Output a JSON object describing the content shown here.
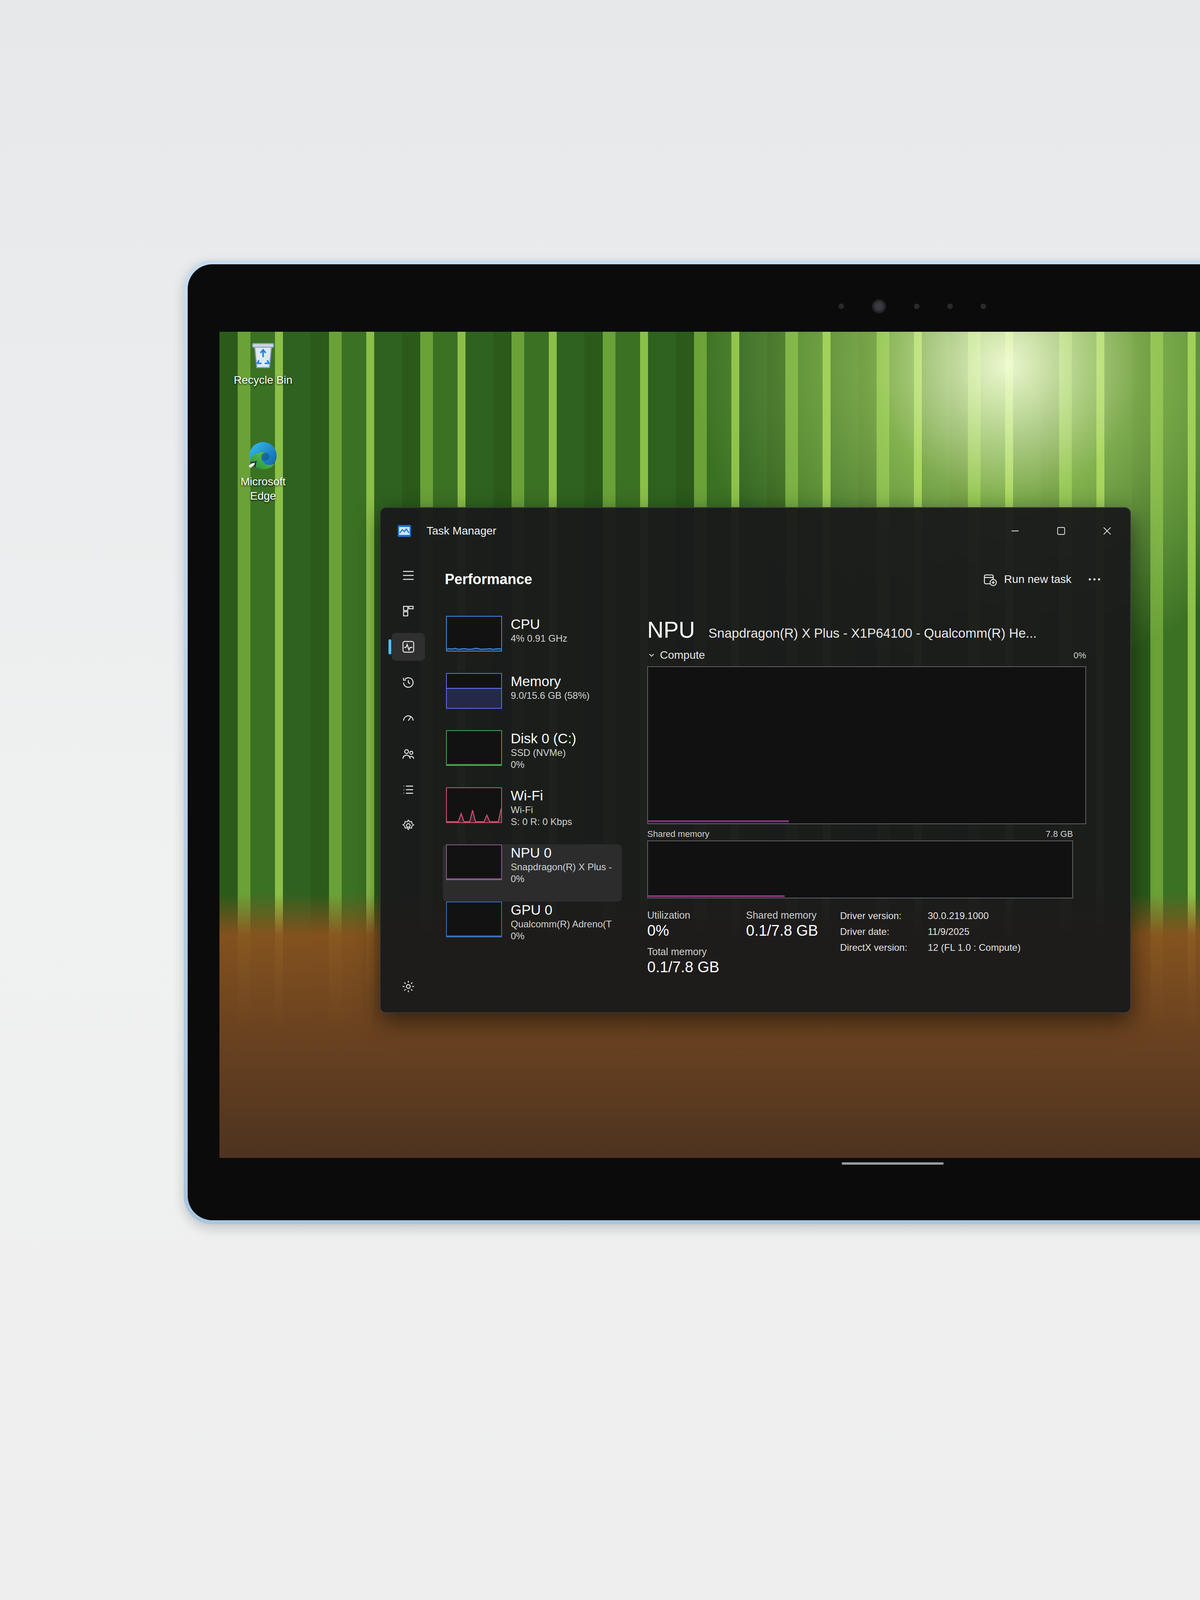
{
  "desktop_icons": [
    {
      "label": "Recycle Bin"
    },
    {
      "label": "Microsoft Edge"
    }
  ],
  "window": {
    "title": "Task Manager"
  },
  "nav_rail": [
    {
      "selected": false
    },
    {
      "selected": true
    },
    {
      "selected": false
    },
    {
      "selected": false
    },
    {
      "selected": false
    },
    {
      "selected": false
    },
    {
      "selected": false
    }
  ],
  "page": {
    "title": "Performance",
    "run_new_task": "Run new task"
  },
  "devices": [
    {
      "name": "CPU",
      "lines": [
        "4% 0.91 GHz"
      ],
      "selected": false,
      "color": "#3b8ee8",
      "history": [
        3,
        5,
        4,
        6,
        3,
        4,
        5,
        4,
        3,
        4,
        6,
        5,
        3,
        4,
        4,
        5,
        3,
        4,
        5,
        4
      ]
    },
    {
      "name": "Memory",
      "lines": [
        "9.0/15.6 GB (58%)"
      ],
      "selected": false,
      "color": "#5a6ee6",
      "history": [
        58,
        58,
        58,
        58,
        58,
        58,
        58,
        58,
        58,
        58,
        58,
        58,
        58,
        58,
        58,
        58,
        58,
        58,
        58,
        58
      ]
    },
    {
      "name": "Disk 0 (C:)",
      "lines": [
        "SSD (NVMe)",
        "0%"
      ],
      "selected": false,
      "color": "#4a9e4c",
      "history": [
        0,
        0,
        0,
        0,
        0,
        0,
        0,
        0,
        0,
        0,
        0,
        0,
        0,
        0,
        0,
        0,
        0,
        0,
        0,
        0
      ]
    },
    {
      "name": "Wi-Fi",
      "lines": [
        "Wi-Fi",
        "S: 0 R: 0 Kbps"
      ],
      "selected": false,
      "color": "#d0506e",
      "history": [
        0,
        0,
        0,
        0,
        0,
        25,
        0,
        0,
        0,
        35,
        0,
        0,
        0,
        0,
        20,
        0,
        0,
        0,
        0,
        40
      ]
    },
    {
      "name": "NPU 0",
      "lines": [
        "Snapdragon(R) X Plus -",
        "0%"
      ],
      "selected": true,
      "color": "#8e5a8a",
      "history": [
        0,
        0,
        0,
        0,
        0,
        0,
        0,
        0,
        0,
        0,
        0,
        0,
        0,
        0,
        0,
        0,
        0,
        0,
        0,
        0
      ]
    },
    {
      "name": "GPU 0",
      "lines": [
        "Qualcomm(R) Adreno(T",
        "0%"
      ],
      "selected": false,
      "color": "#3b6fb8",
      "history": [
        0,
        0,
        0,
        0,
        0,
        0,
        0,
        0,
        0,
        0,
        0,
        0,
        0,
        0,
        0,
        0,
        0,
        0,
        0,
        0
      ]
    }
  ],
  "detail": {
    "title": "NPU",
    "device_name": "Snapdragon(R) X Plus - X1P64100 - Qualcomm(R) He...",
    "compute_label": "Compute",
    "compute_value": "0%",
    "compute_history": [
      0,
      0,
      0,
      0,
      0,
      0,
      0,
      0,
      0,
      0,
      0,
      0,
      0,
      0,
      0,
      0,
      0,
      0,
      0,
      0
    ],
    "shared_label": "Shared memory",
    "shared_max": "7.8 GB",
    "shared_history": [
      0.1,
      0.1,
      0.1,
      0.1,
      0.1,
      0.1,
      0.1,
      0.1,
      0.1,
      0.1,
      0.1,
      0.1,
      0.1,
      0.1,
      0.1,
      0.1,
      0.1,
      0.1,
      0.1,
      0.1
    ],
    "stats": [
      {
        "label": "Utilization",
        "value": "0%"
      },
      {
        "label": "Shared memory",
        "value": "0.1/7.8 GB"
      },
      {
        "label": "Total memory",
        "value": "0.1/7.8 GB"
      }
    ],
    "properties": [
      {
        "label": "Driver version:",
        "value": "30.0.219.1000"
      },
      {
        "label": "Driver date:",
        "value": "11/9/2025"
      },
      {
        "label": "DirectX version:",
        "value": "12 (FL 1.0 : Compute)"
      }
    ]
  }
}
